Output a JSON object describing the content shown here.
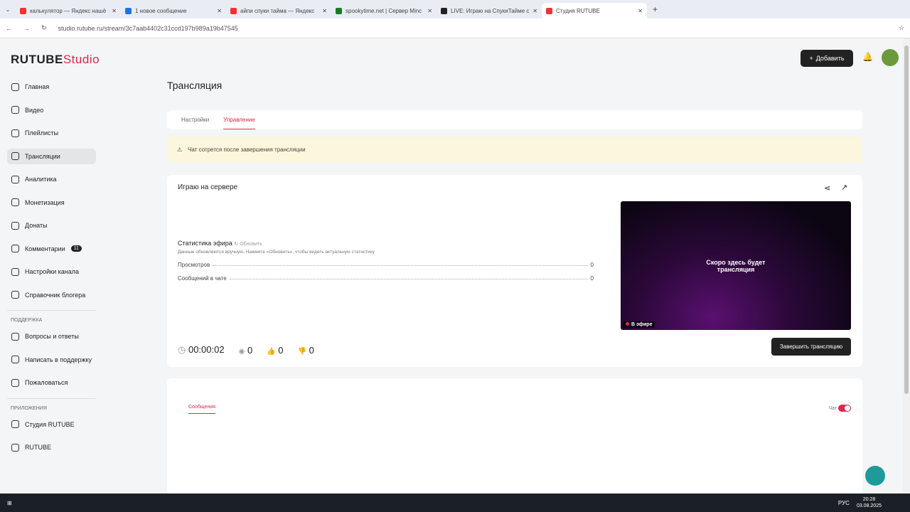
{
  "browser": {
    "tabs": [
      {
        "title": "калькулятор — Яндекс нашё"
      },
      {
        "title": "1 новое сообщение"
      },
      {
        "title": "айпи спуки тайма — Яндекс"
      },
      {
        "title": "spookytime.net | Сервер Minc"
      },
      {
        "title": "LIVE: Играю на СпукиТайме с"
      },
      {
        "title": "Студия RUTUBE"
      }
    ],
    "url": "studio.rutube.ru/stream/3c7aab4402c31ccd197b989a19b47545"
  },
  "logo": {
    "main": "RUTUBE",
    "sub": "Studio"
  },
  "sidebar": {
    "items": [
      {
        "label": "Главная"
      },
      {
        "label": "Видео"
      },
      {
        "label": "Плейлисты"
      },
      {
        "label": "Трансляции"
      },
      {
        "label": "Аналитика"
      },
      {
        "label": "Монетизация"
      },
      {
        "label": "Донаты"
      },
      {
        "label": "Комментарии",
        "badge": "11"
      },
      {
        "label": "Настройки канала"
      },
      {
        "label": "Справочник блогера"
      }
    ],
    "support_title": "ПОДДЕРЖКА",
    "support": [
      {
        "label": "Вопросы и ответы"
      },
      {
        "label": "Написать в поддержку"
      },
      {
        "label": "Пожаловаться"
      }
    ],
    "apps_title": "ПРИЛОЖЕНИЯ",
    "apps": [
      {
        "label": "Студия RUTUBE"
      },
      {
        "label": "RUTUBE"
      }
    ]
  },
  "header": {
    "add_label": "Добавить"
  },
  "page": {
    "title": "Трансляция",
    "tabs": [
      "Настройки",
      "Управление"
    ],
    "warning": "Чат сотрется после завершения трансляции",
    "stream_title": "Играю на сервере",
    "stats_title": "Статистика эфира",
    "refresh": "Обновить",
    "stats_note": "Данные обновляются вручную. Нажмите «Обновить», чтобы видеть актуальную статистику",
    "stats": [
      {
        "label": "Просмотров",
        "value": "0"
      },
      {
        "label": "Сообщений в чате",
        "value": "0"
      }
    ],
    "video_text": "Скоро здесь будет трансляция",
    "live_label": "В эфире",
    "timer": "00:00:02",
    "viewers": "0",
    "likes": "0",
    "dislikes": "0",
    "end_button": "Завершить трансляцию",
    "chat_tab": "Сообщения",
    "chat_toggle_label": "Чат"
  },
  "taskbar": {
    "lang": "РУС",
    "time": "20:28",
    "date": "03.08.2025"
  }
}
